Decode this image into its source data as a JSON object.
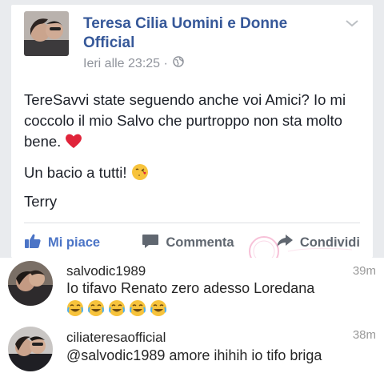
{
  "post": {
    "author": "Teresa Cilia Uomini e Donne Official",
    "time": "Ieri alle 23:25 · ",
    "paragraphs": [
      "TereSavvi state seguendo anche voi Amici? Io mi coccolo il mio Salvo che purtroppo non sta molto bene.",
      "Un bacio a tutti!",
      "Terry"
    ],
    "emoji_after_p1": "heart",
    "emoji_after_p2": "kiss-face"
  },
  "actions": {
    "like": "Mi piace",
    "comment": "Commenta",
    "share": "Condividi"
  },
  "comments": [
    {
      "user": "salvodic1989",
      "time": "39m",
      "text": "Io tifavo Renato zero adesso Loredana",
      "emoji_count": 5,
      "emoji": "joy-face"
    },
    {
      "user": "ciliateresaofficial",
      "time": "38m",
      "text": "@salvodic1989 amore ihihih io tifo briga"
    }
  ],
  "colors": {
    "link": "#365899",
    "like": "#4b74c6",
    "meta": "#90949c",
    "text": "#1d2129"
  }
}
